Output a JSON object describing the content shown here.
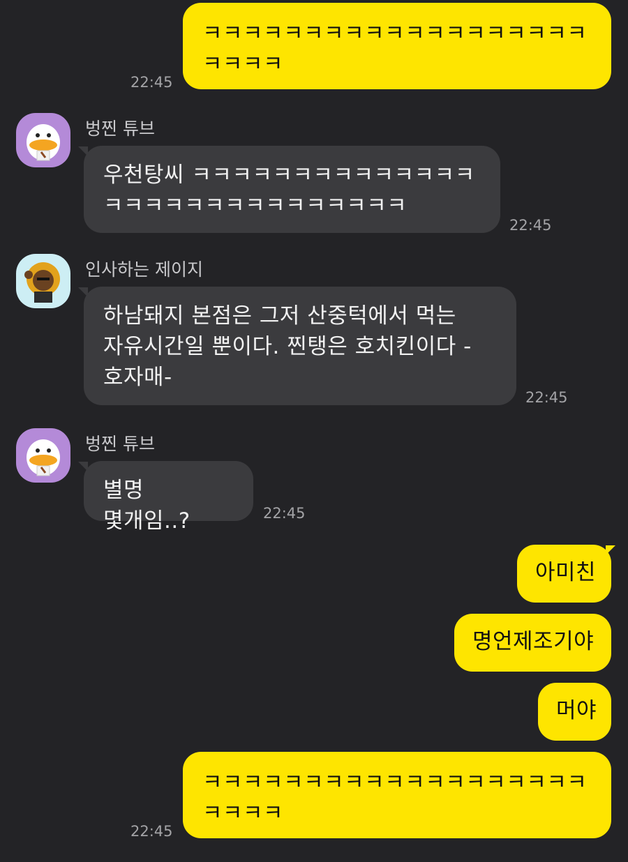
{
  "messages": [
    {
      "id": "m1",
      "from": "me",
      "text": "ㅋㅋㅋㅋㅋㅋㅋㅋㅋㅋㅋㅋㅋㅋㅋㅋㅋㅋㅋ ㅋㅋㅋㅋ",
      "time": "22:45"
    },
    {
      "id": "m2",
      "from": "벙찐 튜브",
      "sender": "벙찐 튜브",
      "text": "우천탕씨 ㅋㅋㅋㅋㅋㅋㅋㅋㅋㅋㅋㅋㅋㅋ ㅋㅋㅋㅋㅋㅋㅋㅋㅋㅋㅋㅋㅋㅋㅋ",
      "time": "22:45"
    },
    {
      "id": "m3",
      "from": "인사하는 제이지",
      "sender": "인사하는 제이지",
      "text": "하남돼지 본점은 그저 산중턱에서 먹는 자유시간일 뿐이다. 찐탱은 호치킨이다 -호자매-",
      "time": "22:45"
    },
    {
      "id": "m4",
      "from": "벙찐 튜브",
      "sender": "벙찐 튜브",
      "text": "별명 몇개임..?",
      "time": "22:45"
    },
    {
      "id": "m5",
      "from": "me",
      "text": "아미친"
    },
    {
      "id": "m6",
      "from": "me",
      "text": "명언제조기야"
    },
    {
      "id": "m7",
      "from": "me",
      "text": "머야"
    },
    {
      "id": "m8",
      "from": "me",
      "text": "ㅋㅋㅋㅋㅋㅋㅋㅋㅋㅋㅋㅋㅋㅋㅋㅋㅋㅋㅋ ㅋㅋㅋㅋ",
      "time": "22:45"
    }
  ],
  "colors": {
    "background": "#232326",
    "my_bubble": "#fee500",
    "their_bubble": "#3b3b3e",
    "avatar_tube": "#b48ad8",
    "avatar_jayg": "#cdeef4"
  },
  "icons": {
    "avatar_tube": "tube-duck-avatar-icon",
    "avatar_jayg": "jay-g-avatar-icon"
  }
}
